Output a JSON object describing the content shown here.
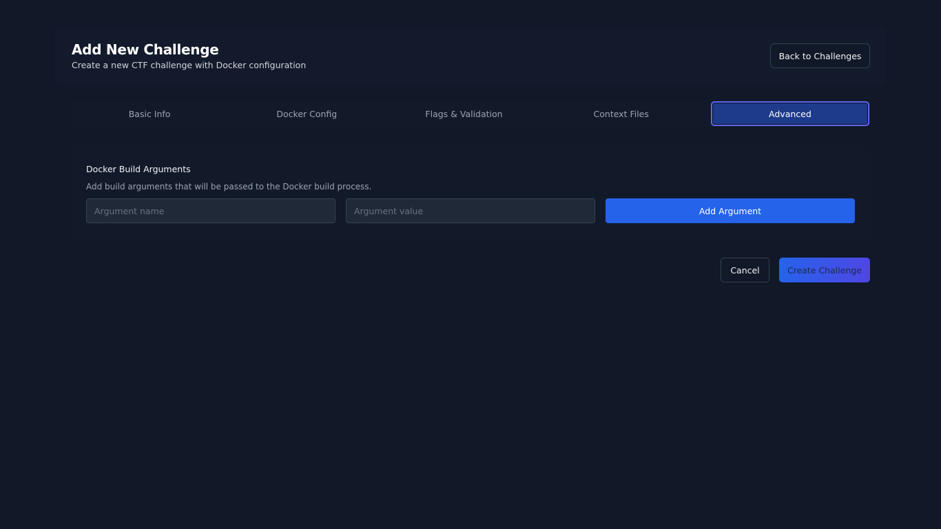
{
  "header": {
    "title": "Add New Challenge",
    "subtitle": "Create a new CTF challenge with Docker configuration",
    "back_label": "Back to Challenges"
  },
  "tabs": [
    {
      "label": "Basic Info"
    },
    {
      "label": "Docker Config"
    },
    {
      "label": "Flags & Validation"
    },
    {
      "label": "Context Files"
    },
    {
      "label": "Advanced",
      "active": true
    }
  ],
  "build_args": {
    "title": "Docker Build Arguments",
    "description": "Add build arguments that will be passed to the Docker build process.",
    "name_placeholder": "Argument name",
    "value_placeholder": "Argument value",
    "name_value": "",
    "value_value": "",
    "add_label": "Add Argument"
  },
  "footer": {
    "cancel_label": "Cancel",
    "create_label": "Create Challenge"
  },
  "colors": {
    "background": "#111827",
    "accent": "#2563eb",
    "active_tab": "#1e3a8a",
    "focus_ring": "#6366f1"
  }
}
